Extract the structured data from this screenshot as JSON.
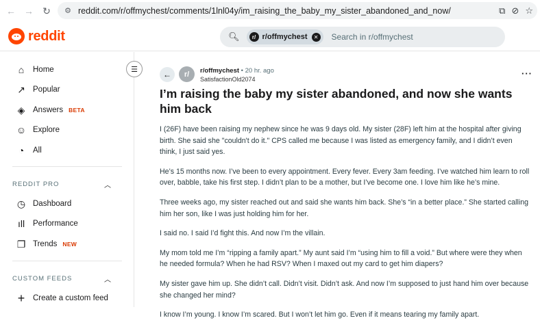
{
  "browser": {
    "url": "reddit.com/r/offmychest/comments/1lnl04y/im_raising_the_baby_my_sister_abandoned_and_now/",
    "back_glyph": "←",
    "forward_glyph": "→",
    "reload_glyph": "↻"
  },
  "header": {
    "logo_text": "reddit",
    "search_chip_label": "r/offmychest",
    "search_placeholder": "Search in r/offmychest",
    "brand_color": "#ff4500"
  },
  "sidebar": {
    "items": [
      {
        "label": "Home",
        "icon": "home-icon"
      },
      {
        "label": "Popular",
        "icon": "popular-icon"
      },
      {
        "label": "Answers",
        "icon": "answers-icon",
        "badge": "BETA"
      },
      {
        "label": "Explore",
        "icon": "explore-icon"
      },
      {
        "label": "All",
        "icon": "all-icon"
      }
    ],
    "pro_section_title": "REDDIT PRO",
    "pro_items": [
      {
        "label": "Dashboard",
        "icon": "dashboard-icon"
      },
      {
        "label": "Performance",
        "icon": "performance-icon"
      },
      {
        "label": "Trends",
        "icon": "trends-icon",
        "badge": "NEW"
      }
    ],
    "feeds_section_title": "CUSTOM FEEDS",
    "feeds_items": [
      {
        "label": "Create a custom feed",
        "icon": "plus-icon"
      }
    ]
  },
  "post": {
    "subreddit": "r/offmychest",
    "time": " • 20 hr. ago",
    "author": "SatisfactionOld2074",
    "title": "I’m raising the baby my sister abandoned, and now she wants him back",
    "paragraphs": [
      "I (26F) have been raising my nephew since he was 9 days old. My sister (28F) left him at the hospital after giving birth. She said she \"couldn't do it.\" CPS called me because I was listed as emergency family, and I didn’t even think, I just said yes.",
      "He’s 15 months now. I’ve been to every appointment. Every fever. Every 3am feeding. I’ve watched him learn to roll over, babble, take his first step. I didn’t plan to be a mother, but I’ve become one. I love him like he’s mine.",
      "Three weeks ago, my sister reached out and said she wants him back. She’s “in a better place.” She started calling him her son, like I was just holding him for her.",
      "I said no. I said I’d fight this. And now I’m the villain.",
      "My mom told me I’m “ripping a family apart.” My aunt said I’m “using him to fill a void.” But where were they when he needed formula? When he had RSV? When I maxed out my card to get him diapers?",
      "My sister gave him up. She didn’t call. Didn’t visit. Didn’t ask. And now I’m supposed to just hand him over because she changed her mind?",
      "I know I’m young. I know I’m scared. But I won’t let him go. Even if it means tearing my family apart."
    ]
  }
}
